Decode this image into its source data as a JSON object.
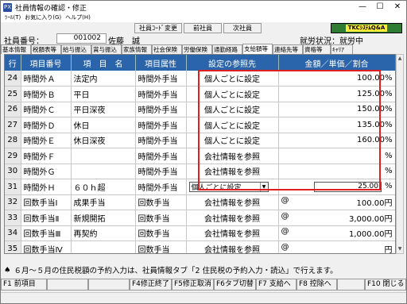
{
  "window": {
    "title": "社員情報の確認・修正",
    "app_icon": "PX",
    "minimize": "—",
    "maximize": "☐",
    "close": "✕"
  },
  "menu": [
    "ﾂｰﾙ(T)",
    "お気に入り(G)",
    "ヘルプ(H)"
  ],
  "toolbar": {
    "employee_code_change": "社員ｺｰﾄﾞ変更",
    "prev_employee": "前社員",
    "next_employee": "次社員",
    "brand": "TKCｼｽﾃﾑQ&A"
  },
  "header": {
    "employee_label": "社員番号：",
    "employee_number": "001002",
    "employee_name": "佐藤　誠",
    "status_label": "就労状況：",
    "status_value": "就労中"
  },
  "tabs": [
    "基本情報",
    "税額表等",
    "給与振込",
    "賞与振込",
    "家族情報",
    "社会保険",
    "労働保険",
    "通勤経路",
    "支給額等",
    "連絡先等",
    "資格等",
    "ｷｬﾘｱ"
  ],
  "active_tab": 8,
  "table": {
    "headers": [
      "行",
      "項目番号",
      "項　目　名",
      "項目属性",
      "設定の参照先",
      "金額／単価／割合"
    ],
    "rows": [
      {
        "no": "24",
        "code": "時間外Ａ",
        "name": "法定内",
        "attr": "時間外手当",
        "ref": "個人ごとに設定",
        "prefix": "",
        "amount": "100.00%"
      },
      {
        "no": "25",
        "code": "時間外Ｂ",
        "name": "平日",
        "attr": "時間外手当",
        "ref": "個人ごとに設定",
        "prefix": "",
        "amount": "125.00%"
      },
      {
        "no": "26",
        "code": "時間外Ｃ",
        "name": "平日深夜",
        "attr": "時間外手当",
        "ref": "個人ごとに設定",
        "prefix": "",
        "amount": "150.00%"
      },
      {
        "no": "27",
        "code": "時間外Ｄ",
        "name": "休日",
        "attr": "時間外手当",
        "ref": "個人ごとに設定",
        "prefix": "",
        "amount": "135.00%"
      },
      {
        "no": "28",
        "code": "時間外Ｅ",
        "name": "休日深夜",
        "attr": "時間外手当",
        "ref": "個人ごとに設定",
        "prefix": "",
        "amount": "160.00%"
      },
      {
        "no": "29",
        "code": "時間外Ｆ",
        "name": "",
        "attr": "時間外手当",
        "ref": "会社情報を参照",
        "prefix": "",
        "amount": "%"
      },
      {
        "no": "30",
        "code": "時間外Ｇ",
        "name": "",
        "attr": "時間外手当",
        "ref": "会社情報を参照",
        "prefix": "",
        "amount": "%"
      },
      {
        "no": "31",
        "code": "時間外Ｈ",
        "name": "６０ｈ超",
        "attr": "時間外手当",
        "ref": "個人ごとに設定",
        "prefix": "",
        "amount": "25.00",
        "unit": "%",
        "editing": true
      },
      {
        "no": "32",
        "code": "回数手当Ⅰ",
        "name": "成果手当",
        "attr": "回数手当",
        "ref": "会社情報を参照",
        "prefix": "@",
        "amount": "100.00円"
      },
      {
        "no": "33",
        "code": "回数手当Ⅱ",
        "name": "新規開拓",
        "attr": "回数手当",
        "ref": "会社情報を参照",
        "prefix": "@",
        "amount": "3,000.00円"
      },
      {
        "no": "34",
        "code": "回数手当Ⅲ",
        "name": "再契約",
        "attr": "回数手当",
        "ref": "会社情報を参照",
        "prefix": "@",
        "amount": "1,000.00円"
      },
      {
        "no": "35",
        "code": "回数手当Ⅳ",
        "name": "",
        "attr": "回数手当",
        "ref": "会社情報を参照",
        "prefix": "@",
        "amount": "円"
      }
    ]
  },
  "message": {
    "icon": "♠",
    "text": "６月～５月の住民税額の予約入力は、社員情報タブ「2 住民税の予約入力・読込」で行えます。"
  },
  "fkeys": [
    "F1 前項目",
    "",
    "",
    "F4修正終了",
    "F5修正取消",
    "F6タブ切替",
    "F7 支給へ",
    "F8 控除へ",
    "",
    "F10 閉じる"
  ],
  "colors": {
    "header_blue": "#2a64aa",
    "highlight_red": "#e02020",
    "brand_green": "#2e7d32"
  }
}
